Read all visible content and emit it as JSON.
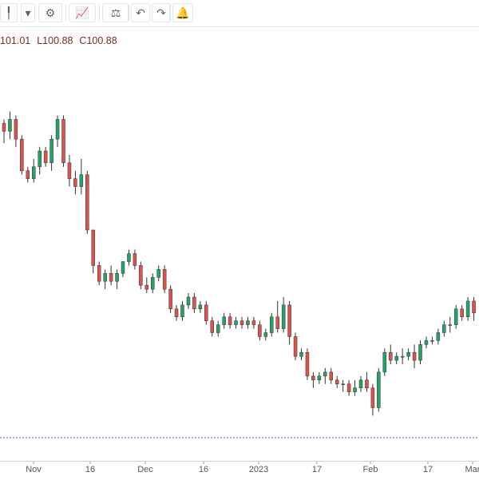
{
  "toolbar": {
    "buttons": [
      {
        "name": "candle-type-button",
        "icon": "candle-icon",
        "glyph": "╿"
      },
      {
        "name": "chart-type-dropdown",
        "icon": "chevron-down-icon",
        "glyph": "▾"
      },
      {
        "name": "settings-button",
        "icon": "gear-icon",
        "glyph": "⚙"
      },
      {
        "name": "indicators-button",
        "icon": "indicators-icon",
        "glyph": "📈"
      },
      {
        "name": "compare-button",
        "icon": "scale-icon",
        "glyph": "⚖"
      },
      {
        "name": "undo-button",
        "icon": "undo-icon",
        "glyph": "↶"
      },
      {
        "name": "redo-button",
        "icon": "redo-icon",
        "glyph": "↷"
      },
      {
        "name": "alert-button",
        "icon": "bell-plus-icon",
        "glyph": "🔔"
      }
    ]
  },
  "legend": {
    "open_partial": "101.01",
    "low": "L100.88",
    "close": "C100.88"
  },
  "colors": {
    "up": "#26a269",
    "down": "#d9534f",
    "wick": "#333333",
    "axis": "#555555",
    "price_line": "#3b5bdb"
  },
  "chart_data": {
    "type": "candlestick",
    "x_tick_labels": [
      "Nov",
      "16",
      "Dec",
      "16",
      "2023",
      "17",
      "Feb",
      "17",
      "Mar"
    ],
    "price_line_value": 100.88,
    "candles": [
      [
        120,
        118,
        115,
        121
      ],
      [
        118,
        121,
        116,
        123
      ],
      [
        121,
        116,
        114,
        122
      ],
      [
        116,
        108,
        107,
        117
      ],
      [
        108,
        106,
        105,
        109
      ],
      [
        106,
        109,
        105,
        111
      ],
      [
        109,
        113,
        107,
        114
      ],
      [
        113,
        110,
        109,
        114
      ],
      [
        110,
        116,
        108,
        117
      ],
      [
        116,
        121,
        114,
        122
      ],
      [
        121,
        110,
        109,
        122
      ],
      [
        110,
        106,
        104,
        112
      ],
      [
        106,
        104,
        102,
        108
      ],
      [
        104,
        107,
        102,
        111
      ],
      [
        107,
        93,
        92,
        108
      ],
      [
        93,
        84,
        82,
        93
      ],
      [
        84,
        80,
        79,
        85
      ],
      [
        80,
        82,
        78,
        83
      ],
      [
        82,
        80,
        79,
        84
      ],
      [
        80,
        82,
        78,
        83
      ],
      [
        82,
        85,
        81,
        85
      ],
      [
        85,
        87,
        84,
        88
      ],
      [
        87,
        84,
        83,
        88
      ],
      [
        84,
        79,
        78,
        85
      ],
      [
        79,
        78,
        77,
        81
      ],
      [
        78,
        81,
        77,
        82
      ],
      [
        81,
        83,
        80,
        84
      ],
      [
        83,
        78,
        77,
        84
      ],
      [
        78,
        73,
        72,
        79
      ],
      [
        73,
        71,
        70,
        74
      ],
      [
        71,
        74,
        70,
        75
      ],
      [
        74,
        76,
        73,
        77
      ],
      [
        76,
        73,
        72,
        77
      ],
      [
        73,
        74,
        72,
        75
      ],
      [
        74,
        70,
        69,
        75
      ],
      [
        70,
        67,
        66,
        71
      ],
      [
        67,
        69,
        66,
        70
      ],
      [
        69,
        71,
        68,
        72
      ],
      [
        71,
        69,
        68,
        72
      ],
      [
        69,
        70,
        68,
        71
      ],
      [
        70,
        69,
        68,
        71
      ],
      [
        69,
        70,
        68,
        71
      ],
      [
        70,
        69,
        68,
        71
      ],
      [
        69,
        66,
        65,
        70
      ],
      [
        66,
        67,
        65,
        68
      ],
      [
        67,
        71,
        66,
        72
      ],
      [
        71,
        68,
        67,
        75
      ],
      [
        68,
        74,
        67,
        76
      ],
      [
        74,
        66,
        64,
        75
      ],
      [
        66,
        61,
        60,
        67
      ],
      [
        61,
        62,
        60,
        63
      ],
      [
        62,
        56,
        55,
        63
      ],
      [
        56,
        55,
        53,
        57
      ],
      [
        55,
        56,
        54,
        57
      ],
      [
        56,
        57,
        54,
        58
      ],
      [
        57,
        55,
        54,
        58
      ],
      [
        55,
        54,
        53,
        56
      ],
      [
        54,
        54,
        52,
        55
      ],
      [
        54,
        52,
        51,
        55
      ],
      [
        52,
        53,
        51,
        55
      ],
      [
        53,
        55,
        52,
        56
      ],
      [
        55,
        53,
        52,
        57
      ],
      [
        53,
        48,
        46,
        54
      ],
      [
        48,
        57,
        47,
        58
      ],
      [
        57,
        62,
        56,
        63
      ],
      [
        62,
        60,
        59,
        64
      ],
      [
        60,
        61,
        59,
        62
      ],
      [
        61,
        61,
        59,
        63
      ],
      [
        61,
        62,
        60,
        63
      ],
      [
        62,
        60,
        58,
        64
      ],
      [
        60,
        64,
        59,
        65
      ],
      [
        64,
        65,
        63,
        66
      ],
      [
        65,
        65,
        64,
        66
      ],
      [
        65,
        67,
        64,
        68
      ],
      [
        67,
        69,
        66,
        70
      ],
      [
        69,
        69,
        67,
        71
      ],
      [
        69,
        73,
        68,
        74
      ],
      [
        73,
        71,
        70,
        74
      ],
      [
        71,
        75,
        70,
        76
      ],
      [
        75,
        72,
        70,
        76
      ]
    ]
  }
}
